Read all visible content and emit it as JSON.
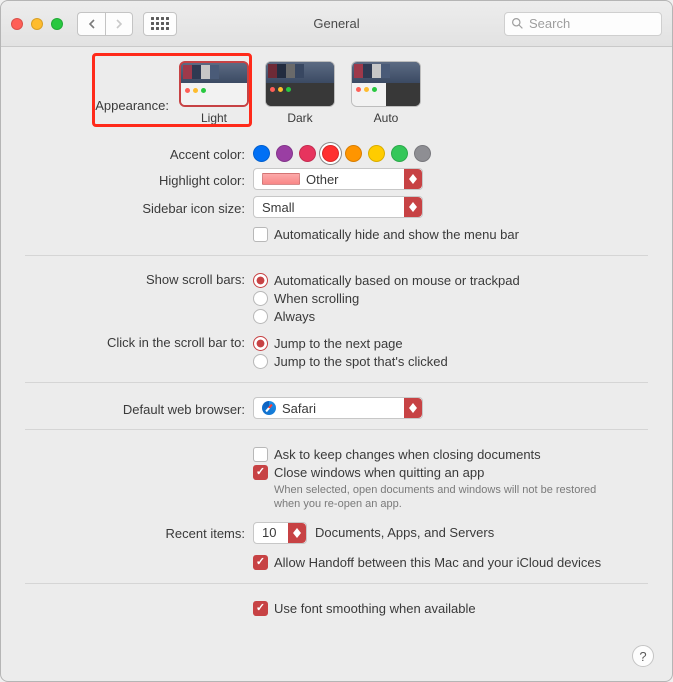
{
  "titlebar": {
    "title": "General",
    "search_placeholder": "Search"
  },
  "appearance": {
    "label": "Appearance:",
    "options": {
      "light": "Light",
      "dark": "Dark",
      "auto": "Auto"
    },
    "selected": "Light"
  },
  "accent": {
    "label": "Accent color:",
    "colors": [
      "#0070f5",
      "#9a3ea3",
      "#e7345e",
      "#ff2f2f",
      "#ff9500",
      "#ffcc00",
      "#34c759",
      "#8e8e93"
    ],
    "selected_index": 3
  },
  "highlight": {
    "label": "Highlight color:",
    "value": "Other"
  },
  "sidebar_size": {
    "label": "Sidebar icon size:",
    "value": "Small"
  },
  "auto_hide_menubar": {
    "label": "Automatically hide and show the menu bar",
    "checked": false
  },
  "scrollbars": {
    "label": "Show scroll bars:",
    "options": {
      "auto": "Automatically based on mouse or trackpad",
      "scrolling": "When scrolling",
      "always": "Always"
    },
    "selected": "auto"
  },
  "click_scroll": {
    "label": "Click in the scroll bar to:",
    "options": {
      "next": "Jump to the next page",
      "spot": "Jump to the spot that's clicked"
    },
    "selected": "next"
  },
  "browser": {
    "label": "Default web browser:",
    "value": "Safari"
  },
  "docs": {
    "ask_keep": {
      "label": "Ask to keep changes when closing documents",
      "checked": false
    },
    "close_quit": {
      "label": "Close windows when quitting an app",
      "checked": true,
      "note": "When selected, open documents and windows will not be restored when you re-open an app."
    }
  },
  "recent": {
    "label": "Recent items:",
    "value": "10",
    "suffix": "Documents, Apps, and Servers"
  },
  "handoff": {
    "label": "Allow Handoff between this Mac and your iCloud devices",
    "checked": true
  },
  "font_smoothing": {
    "label": "Use font smoothing when available",
    "checked": true
  },
  "help": "?"
}
